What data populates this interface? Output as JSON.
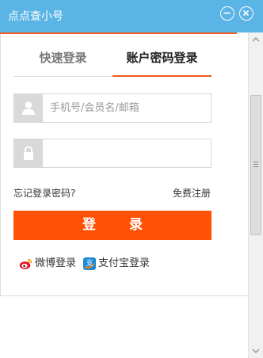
{
  "window": {
    "title": "点点查小号",
    "minimize_icon": "minimize-icon",
    "close_icon": "close-icon",
    "titlebar_color": "#5ab4e5"
  },
  "tabs": [
    {
      "label": "快速登录",
      "active": false
    },
    {
      "label": "账户密码登录",
      "active": true
    }
  ],
  "form": {
    "username": {
      "value": "",
      "placeholder": "手机号/会员名/邮箱",
      "icon": "user-icon"
    },
    "password": {
      "value": "",
      "placeholder": "",
      "icon": "lock-icon"
    }
  },
  "links": {
    "forgot_password": "忘记登录密码?",
    "register": "免费注册"
  },
  "login_button": {
    "label": "登 录",
    "color": "#ff5205"
  },
  "social": [
    {
      "label": "微博登录",
      "icon": "weibo-icon"
    },
    {
      "label": "支付宝登录",
      "icon": "alipay-icon"
    }
  ],
  "accent_color": "#f15a22"
}
